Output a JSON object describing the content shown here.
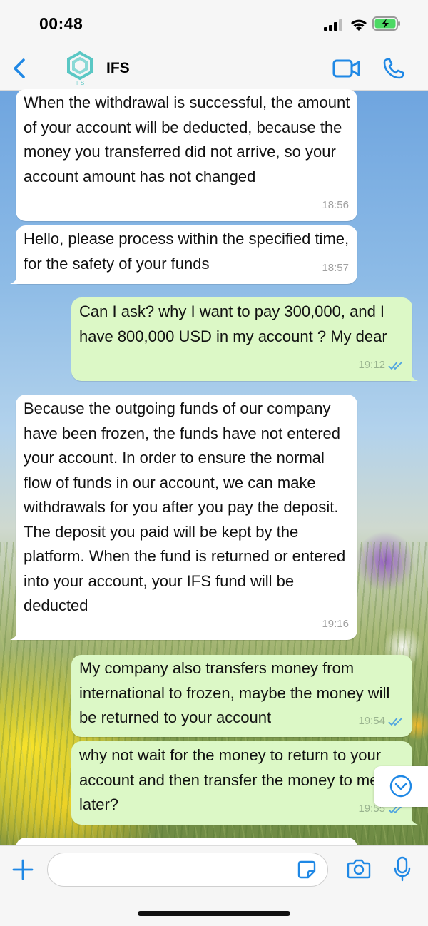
{
  "status_bar": {
    "time": "00:48"
  },
  "header": {
    "contact_name": "IFS",
    "avatar_label": "IFS"
  },
  "messages": [
    {
      "direction": "in",
      "text": "When the withdrawal is successful, the amount of your account will be deducted, because the money you transferred did not arrive, so your account amount has not changed",
      "time": "18:56"
    },
    {
      "direction": "in",
      "text": "Hello, please process within the specified time, for the safety of your funds",
      "time": "18:57"
    },
    {
      "direction": "out",
      "text": "Can I ask? why I want to pay 300,000, and I have 800,000 USD in my account  ? My dear",
      "time": "19:12",
      "status": "read"
    },
    {
      "direction": "in",
      "text": "Because the outgoing funds of our company have been frozen, the funds have not entered your account. In order to ensure the normal flow of funds in our account, we can make withdrawals for you after you pay the deposit. The deposit you paid will be kept by the platform. When the fund is returned or entered into your account, your IFS fund will be deducted",
      "time": "19:16"
    },
    {
      "direction": "out",
      "text": "My company also transfers money from international to frozen, maybe the money will be returned to your account",
      "time": "19:54",
      "status": "read"
    },
    {
      "direction": "out",
      "text": "why not wait for the money to return to your account and then transfer the money to me later?",
      "time": "19:55",
      "status": "read"
    }
  ],
  "input": {
    "placeholder": ""
  },
  "colors": {
    "accent": "#1f88e5",
    "outgoing_bubble": "#dcf8c6",
    "incoming_bubble": "#ffffff",
    "read_tick": "#4fa3e0"
  },
  "icons": [
    "back-chevron-icon",
    "video-camera-icon",
    "phone-icon",
    "plus-icon",
    "sticker-icon",
    "camera-icon",
    "microphone-icon",
    "chevron-down-icon"
  ]
}
